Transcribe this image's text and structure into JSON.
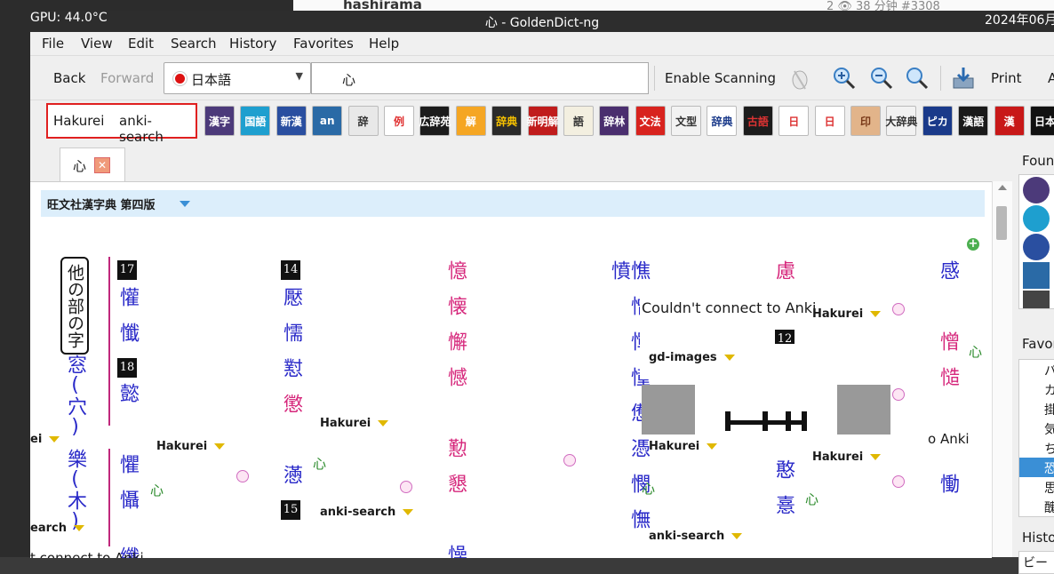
{
  "desktop": {
    "gpu_temp": "GPU: 44.0°C",
    "clock": "2024年06月"
  },
  "background_window": {
    "username": "hashirama",
    "meta": "2 👁 38 分钟 #3308"
  },
  "window": {
    "title": "心 - GoldenDict-ng"
  },
  "menu": [
    "File",
    "View",
    "Edit",
    "Search",
    "History",
    "Favorites",
    "Help"
  ],
  "toolbar": {
    "back": "Back",
    "forward": "Forward",
    "language": "日本語",
    "search_value": "心",
    "enable_scanning": "Enable Scanning",
    "print": "Print",
    "overflow": "A"
  },
  "groups": {
    "left": "Hakurei",
    "right": "anki-search"
  },
  "dictionaries": [
    {
      "label": "漢字",
      "bg": "#4c3a7a",
      "fg": "#fff"
    },
    {
      "label": "国語",
      "bg": "#1e9fcf",
      "fg": "#fff"
    },
    {
      "label": "新漢",
      "bg": "#2a4fa0",
      "fg": "#fff"
    },
    {
      "label": "an",
      "bg": "#2a6aa6",
      "fg": "#fff"
    },
    {
      "label": "辞",
      "bg": "#e8e8e8",
      "fg": "#333"
    },
    {
      "label": "例",
      "bg": "#ffffff",
      "fg": "#e03030"
    },
    {
      "label": "広辞苑",
      "bg": "#1c1c1c",
      "fg": "#fff"
    },
    {
      "label": "解",
      "bg": "#f5a623",
      "fg": "#fff"
    },
    {
      "label": "辞典",
      "bg": "#2a2a2a",
      "fg": "#f5c000"
    },
    {
      "label": "新明解",
      "bg": "#c01c1c",
      "fg": "#fff"
    },
    {
      "label": "語",
      "bg": "#f3efe0",
      "fg": "#333"
    },
    {
      "label": "辞林",
      "bg": "#4a2e6e",
      "fg": "#fff"
    },
    {
      "label": "文法",
      "bg": "#d8231e",
      "fg": "#fff"
    },
    {
      "label": "文型",
      "bg": "#f2f2f2",
      "fg": "#333"
    },
    {
      "label": "辞典",
      "bg": "#ffffff",
      "fg": "#1a3a8a"
    },
    {
      "label": "古語",
      "bg": "#1c1c1c",
      "fg": "#d33"
    },
    {
      "label": "日",
      "bg": "#ffffff",
      "fg": "#d33"
    },
    {
      "label": "日",
      "bg": "#ffffff",
      "fg": "#d33"
    },
    {
      "label": "印",
      "bg": "#e2b48a",
      "fg": "#7a3a1a"
    },
    {
      "label": "大辞典",
      "bg": "#f2f2f2",
      "fg": "#333"
    },
    {
      "label": "ピカ",
      "bg": "#1a3a8a",
      "fg": "#fff"
    },
    {
      "label": "漢語",
      "bg": "#1a1a1a",
      "fg": "#fff"
    },
    {
      "label": "漢",
      "bg": "#c81818",
      "fg": "#fff"
    },
    {
      "label": "日本",
      "bg": "#111111",
      "fg": "#fff"
    }
  ],
  "tab": {
    "label": "心"
  },
  "article": {
    "dict_name": "旺文社漢字典 第四版",
    "radical_label": "他の部の字",
    "col1": [
      {
        "chars": "窓",
        "color": "blue"
      },
      {
        "chars": "(穴)",
        "color": "blue"
      },
      {
        "chars": "樂",
        "color": "blue"
      },
      {
        "chars": "(木)",
        "color": "blue"
      }
    ],
    "stroke_numbers": [
      "17",
      "18",
      "14",
      "15",
      "12"
    ],
    "col2": "懽懺",
    "col2b": "懿",
    "col2c": "懼懾",
    "col2d": "纖",
    "col3": "懕懦懟",
    "col3b": "懲",
    "col3c": "懣",
    "col4": "憶懐懈憾",
    "col4b": "懃懇",
    "col4c": "懆",
    "col5": "憔憎憚憧憊憑憫憮憤",
    "col6": "慮",
    "col6b": "慝",
    "col6c": "憨憙",
    "col7": "感",
    "col7b": "憎慥",
    "col7c": "慟",
    "green_link": "心",
    "frag_hakurei": "Hakurei",
    "frag_anki": "anki-search",
    "frag_gd_images": "gd-images",
    "anki_error": "Couldn't connect to Anki",
    "anki_error_partial": "t connect to Anki",
    "anki_error_clipped": "o Anki",
    "frag_search_partial": "earch",
    "frag_ei_partial": "ei"
  },
  "side_panel": {
    "found_label": "Found",
    "favorites_label": "Favor",
    "history_label": "Histo",
    "history_value": "ビー",
    "favorites_items": [
      "パ",
      "カ",
      "掛",
      "気",
      "ち",
      "恐",
      "思",
      "醜"
    ]
  }
}
